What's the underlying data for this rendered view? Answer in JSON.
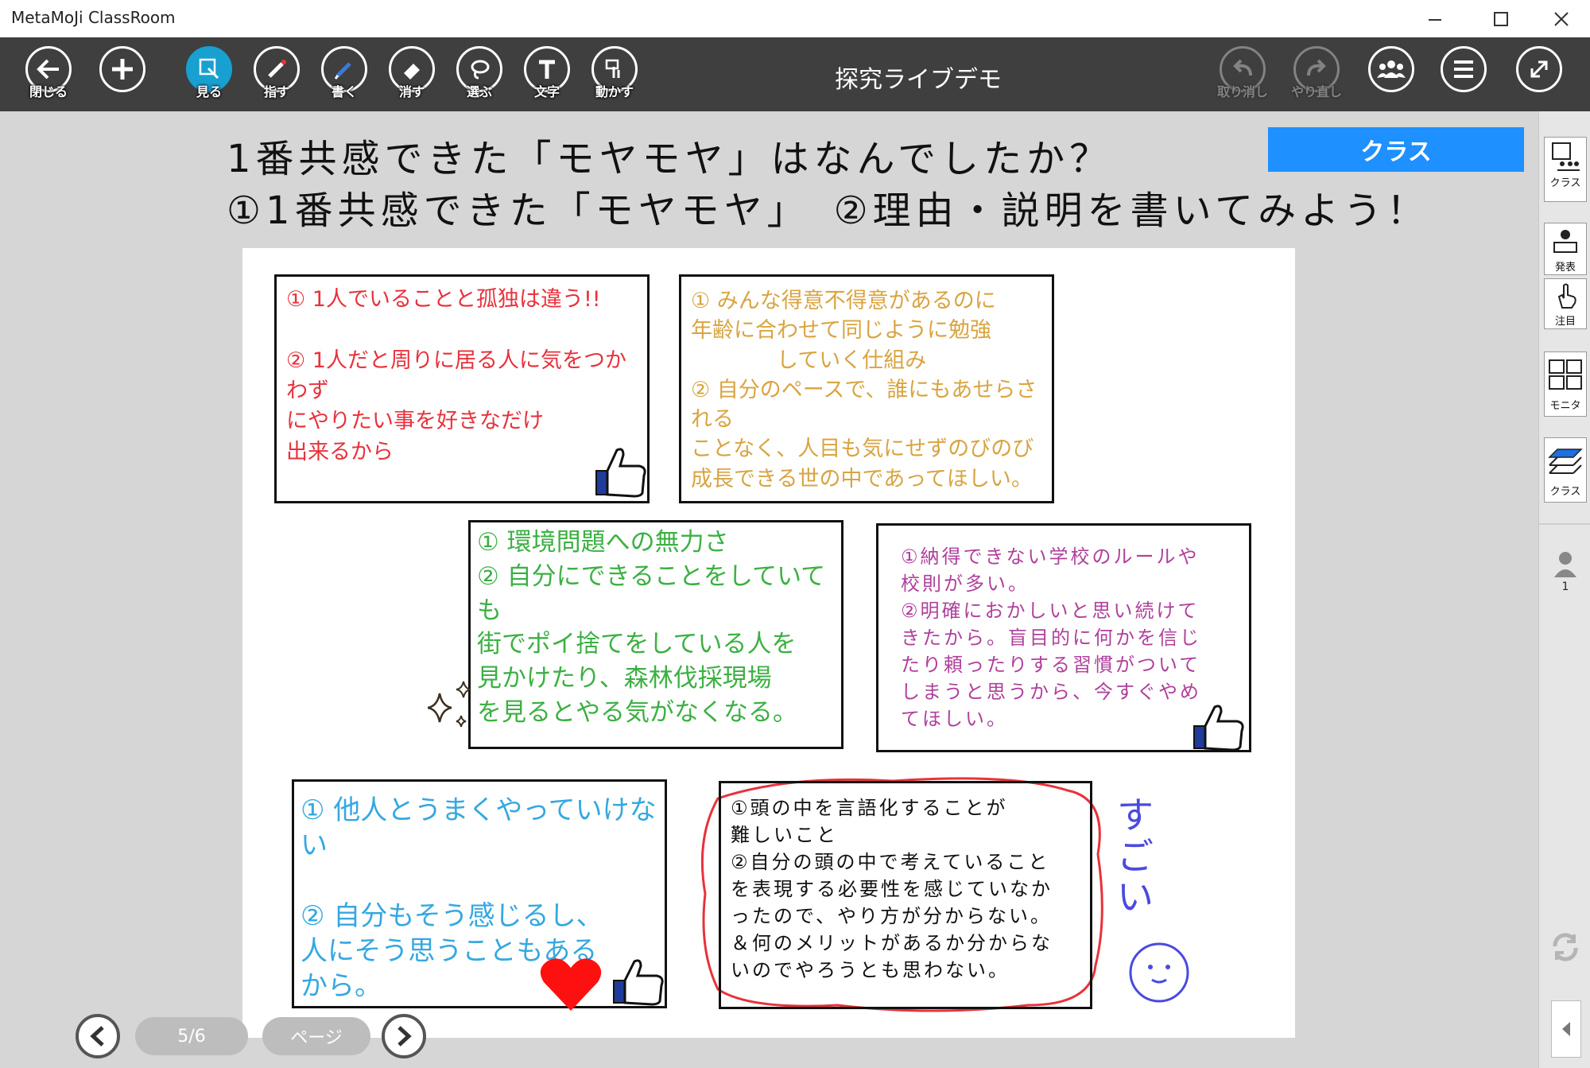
{
  "window": {
    "app_title": "MetaMoJi ClassRoom"
  },
  "toolbar": {
    "close_label": "閉じる",
    "view_label": "見る",
    "point_label": "指す",
    "write_label": "書く",
    "erase_label": "消す",
    "select_label": "選ぶ",
    "text_label": "文字",
    "move_label": "動かす",
    "undo_label": "取り消し",
    "redo_label": "やり直し",
    "doc_title": "探究ライブデモ"
  },
  "header": {
    "line1": "1番共感できた「モヤモヤ」はなんでしたか？",
    "line2": "①1番共感できた「モヤモヤ」　②理由・説明を書いてみよう！",
    "class_banner": "クラス"
  },
  "cards": {
    "red": "① 1人でいることと孤独は違う!!\n\n② 1人だと周りに居る人に気をつかわず\nにやりたい事を好きなだけ\n出来るから",
    "orange": "① みんな得意不得意があるのに\n年齢に合わせて同じように勉強\n　　　　していく仕組み\n② 自分のペースで、誰にもあせらされる\nことなく、人目も気にせずのびのび\n成長できる世の中であってほしい。",
    "green": "① 環境問題への無力さ\n② 自分にできることをしていても\n街でポイ捨てをしている人を\n見かけたり、森林伐採現場\nを見るとやる気がなくなる。",
    "purple": "①納得できない学校のルールや\n校則が多い。\n②明確におかしいと思い続けて\nきたから。盲目的に何かを信じ\nたり頼ったりする習慣がついて\nしまうと思うから、今すぐやめ\nてほしい。",
    "blue": "① 他人とうまくやっていけない\n\n② 自分もそう感じるし、\n人にそう思うこともある\nから。",
    "black": "①頭の中を言語化することが\n難しいこと\n②自分の頭の中で考えていること\nを表現する必要性を感じていなか\nったので、やり方が分からない。\n＆何のメリットがあるか分からな\nいのでやろうとも思わない。",
    "comment": "すごい"
  },
  "sidebar": {
    "class_label": "クラス",
    "present_label": "発表",
    "focus_label": "注目",
    "monitor_label": "モニタ",
    "class2_label": "クラス",
    "user_count": "1"
  },
  "pager": {
    "page_indicator": "5/6",
    "page_button": "ページ"
  },
  "colors": {
    "toolbar": "#3f3f3f",
    "active": "#18a0d0",
    "banner": "#1e90ff",
    "red": "#e8323c",
    "orange": "#d9a441",
    "green": "#3cb043",
    "purple": "#b0409c",
    "blue": "#35a8e0",
    "comment": "#4a4ae0"
  }
}
